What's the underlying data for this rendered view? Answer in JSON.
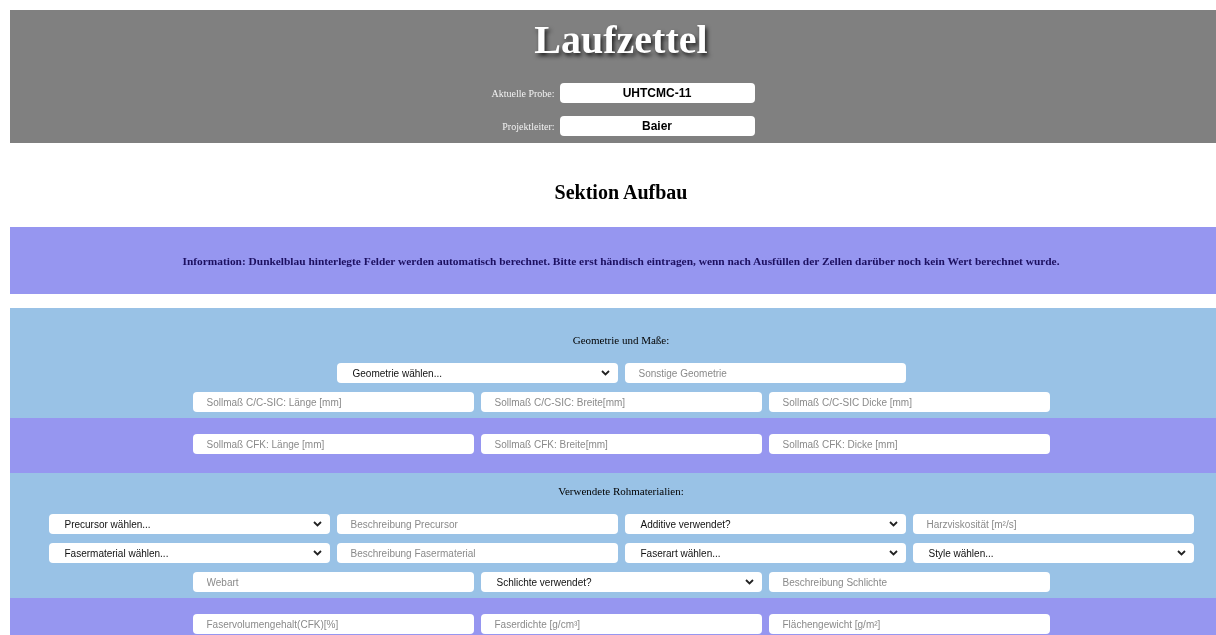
{
  "header": {
    "title": "Laufzettel",
    "fields": [
      {
        "label": "Aktuelle Probe:",
        "value": "UHTCMC-11"
      },
      {
        "label": "Projektleiter:",
        "value": "Baier"
      }
    ]
  },
  "section_title": "Sektion Aufbau",
  "info": "Information: Dunkelblau hinterlegte Felder werden automatisch berechnet. Bitte erst händisch eintragen, wenn nach Ausfüllen der Zellen darüber noch kein Wert berechnet wurde.",
  "sections": [
    {
      "kind": "light",
      "heading": "Geometrie und Maße:",
      "rows": [
        [
          {
            "kind": "select",
            "text": "Geometrie wählen..."
          },
          {
            "kind": "input",
            "placeholder": "Sonstige Geometrie"
          }
        ],
        [
          {
            "kind": "input",
            "placeholder": "Sollmaß C/C-SIC: Länge [mm]"
          },
          {
            "kind": "input",
            "placeholder": "Sollmaß C/C-SIC: Breite[mm]"
          },
          {
            "kind": "input",
            "placeholder": "Sollmaß C/C-SIC Dicke [mm]"
          }
        ]
      ]
    },
    {
      "kind": "dark",
      "rows": [
        [
          {
            "kind": "input",
            "placeholder": "Sollmaß CFK: Länge [mm]"
          },
          {
            "kind": "input",
            "placeholder": "Sollmaß CFK: Breite[mm]"
          },
          {
            "kind": "input",
            "placeholder": "Sollmaß CFK: Dicke [mm]"
          }
        ]
      ]
    },
    {
      "kind": "light",
      "heading": "Verwendete Rohmaterialien:",
      "rows": [
        [
          {
            "kind": "select",
            "text": "Precursor wählen..."
          },
          {
            "kind": "input",
            "placeholder": "Beschreibung Precursor"
          },
          {
            "kind": "select",
            "text": "Additive verwendet?"
          },
          {
            "kind": "input",
            "placeholder": "Harzviskosität [m²/s]"
          }
        ],
        [
          {
            "kind": "select",
            "text": "Fasermaterial wählen..."
          },
          {
            "kind": "input",
            "placeholder": "Beschreibung Fasermaterial"
          },
          {
            "kind": "select",
            "text": "Faserart wählen..."
          },
          {
            "kind": "select",
            "text": "Style wählen..."
          }
        ],
        [
          {
            "kind": "input",
            "placeholder": "Webart"
          },
          {
            "kind": "select",
            "text": "Schlichte verwendet?"
          },
          {
            "kind": "input",
            "placeholder": "Beschreibung Schlichte"
          }
        ]
      ]
    },
    {
      "kind": "dark",
      "rows": [
        [
          {
            "kind": "input",
            "placeholder": "Faservolumengehalt(CFK)[%]"
          },
          {
            "kind": "input",
            "placeholder": "Faserdichte [g/cm³]"
          },
          {
            "kind": "input",
            "placeholder": "Flächengewicht [g/m²]"
          }
        ]
      ]
    }
  ]
}
